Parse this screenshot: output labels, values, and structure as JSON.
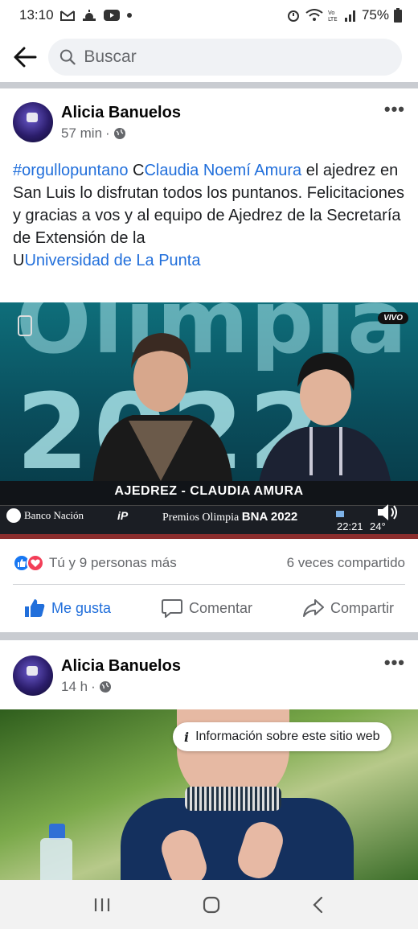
{
  "status_bar": {
    "time": "13:10",
    "battery": "75%"
  },
  "search": {
    "placeholder": "Buscar"
  },
  "post1": {
    "author": "Alicia Banuelos",
    "time": "57 min",
    "text": {
      "hashtag": "#orgullopuntano",
      "mention_prefix": "C",
      "mention": "Claudia Noemí Amura",
      "body": " el ajedrez en San Luis lo disfrutan todos los puntanos. Felicitaciones y gracias a vos y al equipo de Ajedrez de la Secretaría de Extensión de la",
      "link_prefix": "U",
      "link": "Universidad de La Punta"
    },
    "image": {
      "headline": "AJEDREZ - CLAUDIA AMURA",
      "sponsor": "Banco Nación",
      "program_prefix": "Premios Olimpia",
      "program_bold": "BNA 2022",
      "bg_word": "Olimpia",
      "bg_year": "2022",
      "live_badge": "VIVO",
      "clock": "22:21",
      "temperature": "24°",
      "channel_logo": "iP"
    },
    "reactions": "Tú y 9 personas más",
    "shares": "6 veces compartido",
    "actions": {
      "like": "Me gusta",
      "comment": "Comentar",
      "share": "Compartir"
    }
  },
  "post2": {
    "author": "Alicia Banuelos",
    "time": "14 h",
    "info_pill": "Información sobre este sitio web"
  },
  "colors": {
    "link_blue": "#216fdb",
    "like_blue": "#1877f2",
    "love_red": "#f33e58",
    "divider": "#c9ccd1"
  }
}
